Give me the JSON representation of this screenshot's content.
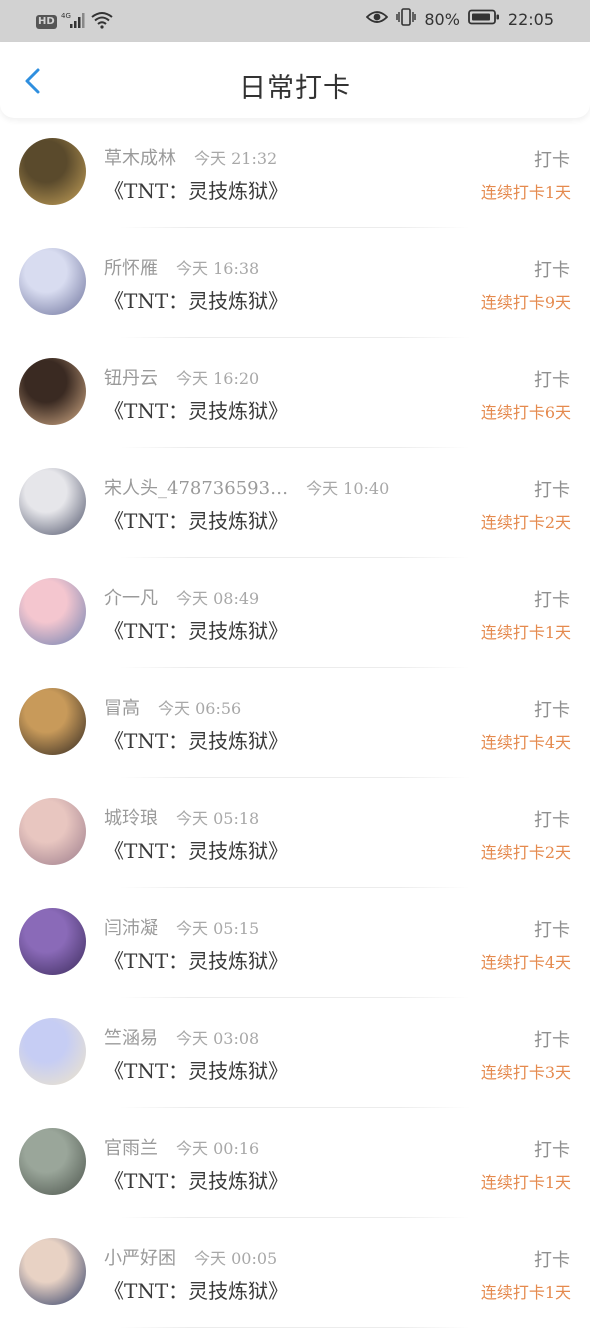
{
  "status_bar": {
    "hd": "HD",
    "network": "4G",
    "battery": "80%",
    "time": "22:05"
  },
  "header": {
    "title": "日常打卡"
  },
  "list": [
    {
      "name": "草木成林",
      "time": "今天 21:32",
      "book": "《TNT：灵技炼狱》",
      "tag": "打卡",
      "streak": "连续打卡1天",
      "avatar_colors": [
        "#5a4a2c",
        "#c8a45a"
      ]
    },
    {
      "name": "所怀雁",
      "time": "今天 16:38",
      "book": "《TNT：灵技炼狱》",
      "tag": "打卡",
      "streak": "连续打卡9天",
      "avatar_colors": [
        "#d8dcf0",
        "#6a6f99"
      ]
    },
    {
      "name": "钮丹云",
      "time": "今天 16:20",
      "book": "《TNT：灵技炼狱》",
      "tag": "打卡",
      "streak": "连续打卡6天",
      "avatar_colors": [
        "#3a2a22",
        "#d8b08a"
      ]
    },
    {
      "name": "宋人头_478736593…",
      "time": "今天 10:40",
      "book": "《TNT：灵技炼狱》",
      "tag": "打卡",
      "streak": "连续打卡2天",
      "avatar_colors": [
        "#e6e6ea",
        "#4a4f66"
      ]
    },
    {
      "name": "介一凡",
      "time": "今天 08:49",
      "book": "《TNT：灵技炼狱》",
      "tag": "打卡",
      "streak": "连续打卡1天",
      "avatar_colors": [
        "#f4c6cf",
        "#6a7fb0"
      ]
    },
    {
      "name": "冒高",
      "time": "今天 06:56",
      "book": "《TNT：灵技炼狱》",
      "tag": "打卡",
      "streak": "连续打卡4天",
      "avatar_colors": [
        "#c89a5a",
        "#2e2620"
      ]
    },
    {
      "name": "城玲琅",
      "time": "今天 05:18",
      "book": "《TNT：灵技炼狱》",
      "tag": "打卡",
      "streak": "连续打卡2天",
      "avatar_colors": [
        "#e8c6c0",
        "#9a7a8a"
      ]
    },
    {
      "name": "闫沛凝",
      "time": "今天 05:15",
      "book": "《TNT：灵技炼狱》",
      "tag": "打卡",
      "streak": "连续打卡4天",
      "avatar_colors": [
        "#8a6ab8",
        "#3a2a5a"
      ]
    },
    {
      "name": "竺涵易",
      "time": "今天 03:08",
      "book": "《TNT：灵技炼狱》",
      "tag": "打卡",
      "streak": "连续打卡3天",
      "avatar_colors": [
        "#c6cdf4",
        "#f0e6c8"
      ]
    },
    {
      "name": "官雨兰",
      "time": "今天 00:16",
      "book": "《TNT：灵技炼狱》",
      "tag": "打卡",
      "streak": "连续打卡1天",
      "avatar_colors": [
        "#9aa69a",
        "#4a524a"
      ]
    },
    {
      "name": "小严好困",
      "time": "今天 00:05",
      "book": "《TNT：灵技炼狱》",
      "tag": "打卡",
      "streak": "连续打卡1天",
      "avatar_colors": [
        "#e8d2c4",
        "#2a3a66"
      ]
    }
  ]
}
